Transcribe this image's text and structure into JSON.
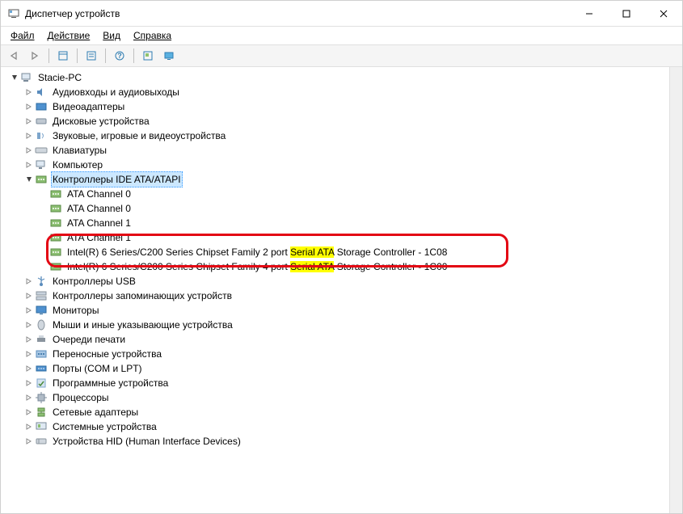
{
  "title": "Диспетчер устройств",
  "menu": {
    "file": "Файл",
    "action": "Действие",
    "view": "Вид",
    "help": "Справка"
  },
  "tree": {
    "root": "Stacie-PC",
    "categories": [
      "Аудиовходы и аудиовыходы",
      "Видеоадаптеры",
      "Дисковые устройства",
      "Звуковые, игровые и видеоустройства",
      "Клавиатуры",
      "Компьютер"
    ],
    "ide": {
      "label": "Контроллеры IDE ATA/ATAPI",
      "children": [
        {
          "text": "ATA Channel 0"
        },
        {
          "text": "ATA Channel 0"
        },
        {
          "text": "ATA Channel 1"
        },
        {
          "text": "ATA Channel 1"
        },
        {
          "pre": "Intel(R) 6 Series/C200 Series Chipset Family 2 port ",
          "hl": "Serial ATA",
          "post": " Storage Controller - 1C08"
        },
        {
          "pre": "Intel(R) 6 Series/C200 Series Chipset Family 4 port ",
          "hl": "Serial ATA",
          "post": " Storage Controller - 1C00"
        }
      ]
    },
    "after": [
      "Контроллеры USB",
      "Контроллеры запоминающих устройств",
      "Мониторы",
      "Мыши и иные указывающие устройства",
      "Очереди печати",
      "Переносные устройства",
      "Порты (COM и LPT)",
      "Программные устройства",
      "Процессоры",
      "Сетевые адаптеры",
      "Системные устройства",
      "Устройства HID (Human Interface Devices)"
    ]
  }
}
